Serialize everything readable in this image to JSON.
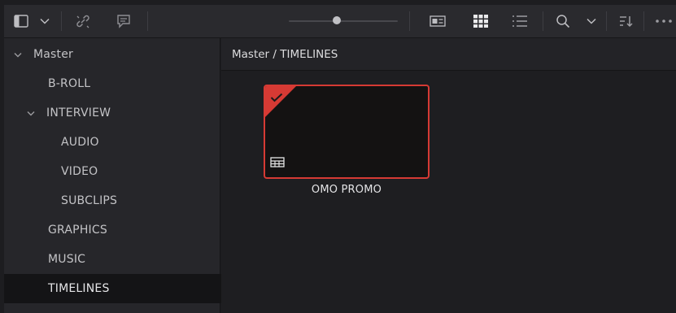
{
  "toolbar": {
    "icons": [
      "sidebar-toggle-icon",
      "chevron-down-icon",
      "unlink-icon",
      "metadata-icon",
      "zoom-slider",
      "metadata-view-icon",
      "thumbnail-view-icon",
      "list-view-icon",
      "search-icon",
      "chevron-down-icon",
      "sort-icon",
      "more-icon"
    ],
    "active_view": "thumbnail"
  },
  "sidebar": {
    "items": [
      {
        "label": "Master",
        "expanded": true
      },
      {
        "label": "B-ROLL"
      },
      {
        "label": "INTERVIEW",
        "expanded": true
      },
      {
        "label": "AUDIO"
      },
      {
        "label": "VIDEO"
      },
      {
        "label": "SUBCLIPS"
      },
      {
        "label": "GRAPHICS"
      },
      {
        "label": "MUSIC"
      },
      {
        "label": "TIMELINES",
        "selected": true
      }
    ]
  },
  "path": {
    "text": "Master / TIMELINES"
  },
  "clips": [
    {
      "name": "OMO PROMO",
      "type": "timeline",
      "selected": true
    }
  ],
  "colors": {
    "accent": "#d63a34",
    "background": "#1e1e21",
    "sidebar": "#26262a"
  }
}
